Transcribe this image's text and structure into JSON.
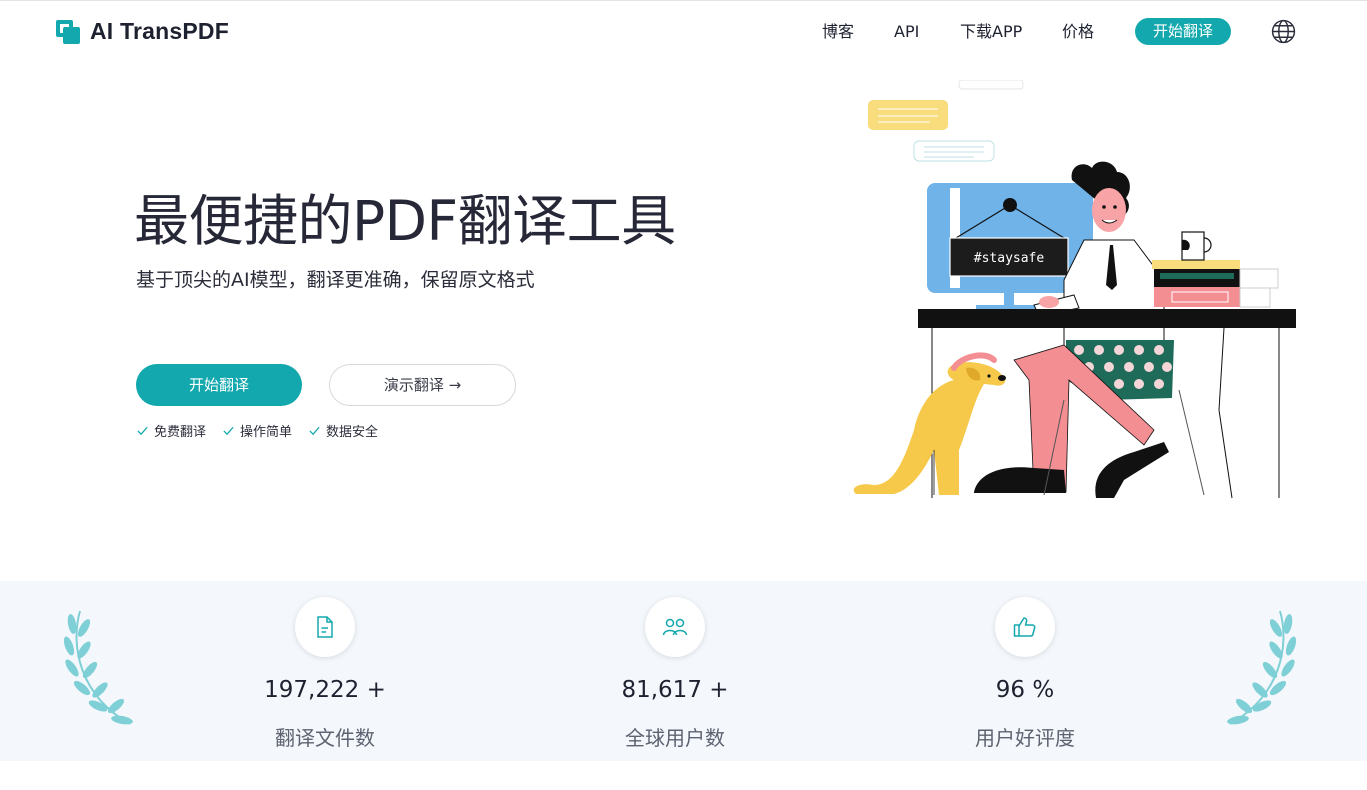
{
  "brand": {
    "name": "AI TransPDF",
    "accent": "#13a8ad"
  },
  "nav": {
    "items": [
      "博客",
      "API",
      "下载APP",
      "价格"
    ],
    "cta": "开始翻译",
    "language_icon": "globe-icon"
  },
  "hero": {
    "title": "最便捷的PDF翻译工具",
    "subtitle": "基于顶尖的AI模型，翻译更准确，保留原文格式",
    "primary_button": "开始翻译",
    "secondary_button": "演示翻译 →",
    "features": [
      "免费翻译",
      "操作简单",
      "数据安全"
    ],
    "illustration_sign": "#staysafe"
  },
  "stats": [
    {
      "icon": "document-icon",
      "value": "197,222 +",
      "label": "翻译文件数"
    },
    {
      "icon": "users-icon",
      "value": "81,617 +",
      "label": "全球用户数"
    },
    {
      "icon": "thumbs-up-icon",
      "value": "96 %",
      "label": "用户好评度"
    }
  ]
}
